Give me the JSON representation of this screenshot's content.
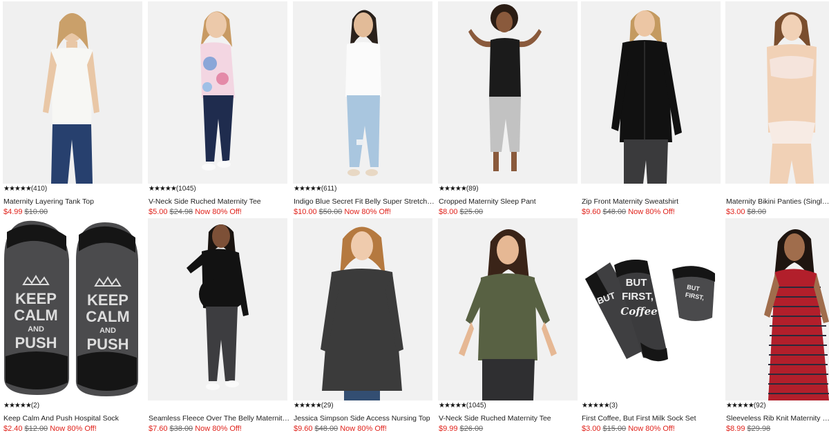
{
  "products": [
    {
      "title": "Maternity Layering Tank Top",
      "stars": "★★★★★",
      "reviews": "(410)",
      "price": "$4.99",
      "original": "$10.00",
      "discount": ""
    },
    {
      "title": "V-Neck Side Ruched Maternity Tee",
      "stars": "★★★★★",
      "reviews": "(1045)",
      "price": "$5.00",
      "original": "$24.98",
      "discount": "Now 80% Off!"
    },
    {
      "title": "Indigo Blue Secret Fit Belly Super Stretch Ski...",
      "stars": "★★★★★",
      "reviews": "(611)",
      "price": "$10.00",
      "original": "$50.00",
      "discount": "Now 80% Off!"
    },
    {
      "title": "Cropped Maternity Sleep Pant",
      "stars": "★★★★★",
      "reviews": "(89)",
      "price": "$8.00",
      "original": "$25.00",
      "discount": ""
    },
    {
      "title": "Zip Front Maternity Sweatshirt",
      "stars": "",
      "reviews": "",
      "price": "$9.60",
      "original": "$48.00",
      "discount": "Now 80% Off!"
    },
    {
      "title": "Maternity Bikini Panties (Single) - P",
      "stars": "",
      "reviews": "",
      "price": "$3.00",
      "original": "$8.00",
      "discount": ""
    },
    {
      "title": "Keep Calm And Push Hospital Sock",
      "stars": "★★★★★",
      "reviews": "(2)",
      "price": "$2.40",
      "original": "$12.00",
      "discount": "Now 80% Off!"
    },
    {
      "title": "Seamless Fleece Over The Belly Maternity L...",
      "stars": "",
      "reviews": "",
      "price": "$7.60",
      "original": "$38.00",
      "discount": "Now 80% Off!"
    },
    {
      "title": "Jessica Simpson Side Access Nursing Top",
      "stars": "★★★★",
      "reviews": "(29)",
      "price": "$9.60",
      "original": "$48.00",
      "discount": "Now 80% Off!"
    },
    {
      "title": "V-Neck Side Ruched Maternity Tee",
      "stars": "★★★★★",
      "reviews": "(1045)",
      "price": "$9.99",
      "original": "$26.00",
      "discount": ""
    },
    {
      "title": "First Coffee, But First Milk Sock Set",
      "stars": "★★★★★",
      "reviews": "(3)",
      "price": "$3.00",
      "original": "$15.00",
      "discount": "Now 80% Off!"
    },
    {
      "title": "Sleeveless Rib Knit Maternity Dress",
      "stars": "★★★★★",
      "reviews": "(92)",
      "price": "$8.99",
      "original": "$29.98",
      "discount": ""
    }
  ],
  "sock_text": {
    "keep": "KEEP",
    "calm": "CALM",
    "and": "AND",
    "push": "PUSH",
    "but": "BUT",
    "first": "FIRST,",
    "coffee": "Coffee"
  },
  "colors": {
    "sale": "#e0231c",
    "original": "#666666",
    "text": "#222222"
  }
}
